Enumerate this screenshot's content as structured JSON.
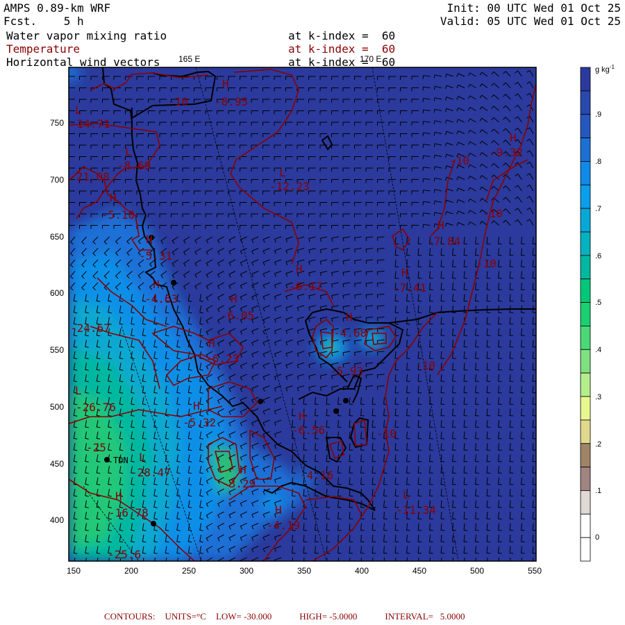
{
  "header": {
    "model": "AMPS 0.89-km WRF",
    "forecast": "Fcst.    5 h",
    "init": "Init: 00 UTC Wed 01 Oct 25",
    "valid": "Valid: 05 UTC Wed 01 Oct 25",
    "fields": [
      {
        "name": "Water vapor mixing ratio",
        "level": "at k-index =  60"
      },
      {
        "name": "Temperature",
        "level": "at k-index =  60"
      },
      {
        "name": "Horizontal wind vectors",
        "level": "at k-index =  60"
      }
    ],
    "lon_labels": [
      "165 E",
      "170 E"
    ]
  },
  "axes": {
    "x_ticks": [
      "150",
      "200",
      "250",
      "300",
      "350",
      "400",
      "450",
      "500",
      "550"
    ],
    "y_ticks": [
      "750",
      "700",
      "650",
      "600",
      "550",
      "500",
      "450",
      "400"
    ]
  },
  "colorbar": {
    "units": "g kg",
    "units_exp": "-1",
    "labels": [
      ".9",
      ".8",
      ".7",
      ".6",
      ".5",
      ".4",
      ".3",
      ".2",
      ".1",
      "0"
    ],
    "colors": [
      "#2b3a9c",
      "#2a49ad",
      "#2558bf",
      "#1c6fd4",
      "#108ae8",
      "#0a9eec",
      "#08a8d6",
      "#04b2c0",
      "#00b8a0",
      "#00c878",
      "#1ad070",
      "#4ad878",
      "#80e080",
      "#b4ee8c",
      "#e8f890",
      "#e0d88c",
      "#a08468",
      "#a08480",
      "#e0d8d4",
      "#ffffff",
      "#ffffff"
    ]
  },
  "map": {
    "station": "TDN",
    "contour_labels": [
      "-10",
      "-8.95",
      "-14.71",
      "-8.69",
      "-12.23",
      "-21.08",
      "-5.10",
      "-5.31",
      "-4.63",
      "-6.05",
      "-9.32",
      "-10",
      "-10",
      "-7.84",
      "-10",
      "-7.41",
      "-6.17",
      "-24.67",
      "-26.76",
      "-25",
      "-28.47",
      "-16.78",
      "-25.6",
      "-5.32",
      "-6.23",
      "-3.29",
      "-4.19",
      "-4.68",
      "-5.93",
      "-10",
      "-6.56",
      "-10",
      "-4.16",
      "-11.34"
    ],
    "hl_markers": [
      "H",
      "L",
      "L",
      "L",
      "H",
      "H",
      "H",
      "H",
      "H",
      "H",
      "H",
      "H",
      "L",
      "L",
      "H",
      "H",
      "H",
      "H",
      "H",
      "H",
      "H",
      "L"
    ]
  },
  "footer": {
    "contours": "CONTOURS:",
    "units": "UNITS=°C",
    "low": "LOW= -30.000",
    "high": "HIGH= -5.0000",
    "interval": "INTERVAL=   5.0000"
  }
}
